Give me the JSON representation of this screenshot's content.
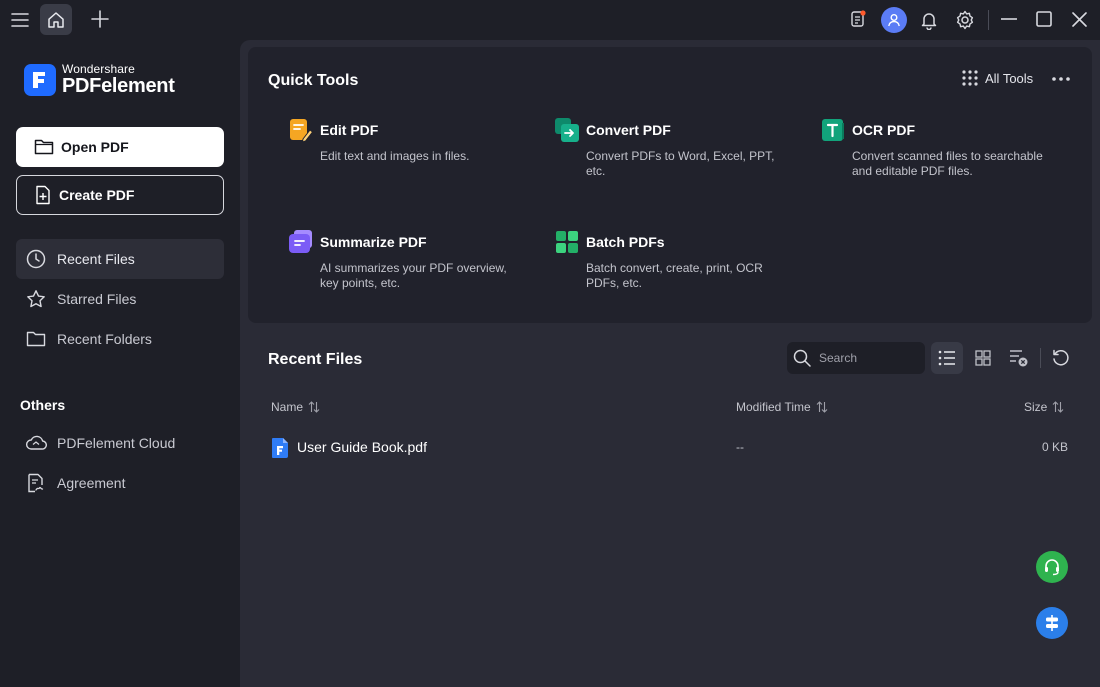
{
  "app": {
    "brand_small": "Wondershare",
    "brand_large": "PDFelement",
    "accent": "#1f6bff"
  },
  "titlebar": {
    "icons": [
      "menu-icon",
      "home-icon",
      "plus-icon",
      "notification-icon",
      "avatar",
      "bell-icon",
      "gear-icon",
      "minimize-icon",
      "maximize-icon",
      "close-icon"
    ]
  },
  "sidebar": {
    "open_pdf": "Open PDF",
    "create_pdf": "Create PDF",
    "nav": [
      {
        "label": "Recent Files",
        "icon": "clock-icon",
        "active": true
      },
      {
        "label": "Starred Files",
        "icon": "star-icon",
        "active": false
      },
      {
        "label": "Recent Folders",
        "icon": "folder-icon",
        "active": false
      }
    ],
    "others_title": "Others",
    "others": [
      {
        "label": "PDFelement Cloud",
        "icon": "cloud-icon"
      },
      {
        "label": "Agreement",
        "icon": "agreement-icon"
      }
    ]
  },
  "quick_tools": {
    "title": "Quick Tools",
    "all_tools": "All Tools",
    "tools": [
      {
        "name": "Edit PDF",
        "desc": "Edit text and images in files.",
        "icon": "edit-pdf-icon",
        "color": "#f5a623"
      },
      {
        "name": "Convert PDF",
        "desc": "Convert PDFs to Word, Excel, PPT, etc.",
        "icon": "convert-pdf-icon",
        "color": "#17b08b"
      },
      {
        "name": "OCR PDF",
        "desc": "Convert scanned files to searchable and editable PDF files.",
        "icon": "ocr-pdf-icon",
        "color": "#12a37b"
      },
      {
        "name": "Summarize PDF",
        "desc": "AI summarizes your PDF overview, key points, etc.",
        "icon": "summarize-pdf-icon",
        "color": "#7b5cf6"
      },
      {
        "name": "Batch PDFs",
        "desc": "Batch convert, create, print, OCR PDFs, etc.",
        "icon": "batch-pdfs-icon",
        "color": "#23b067"
      }
    ]
  },
  "recent_files": {
    "title": "Recent Files",
    "search_placeholder": "Search",
    "columns": {
      "name": "Name",
      "modified": "Modified Time",
      "size": "Size"
    },
    "files": [
      {
        "name": "User Guide Book.pdf",
        "modified": "--",
        "size": "0 KB"
      }
    ]
  }
}
